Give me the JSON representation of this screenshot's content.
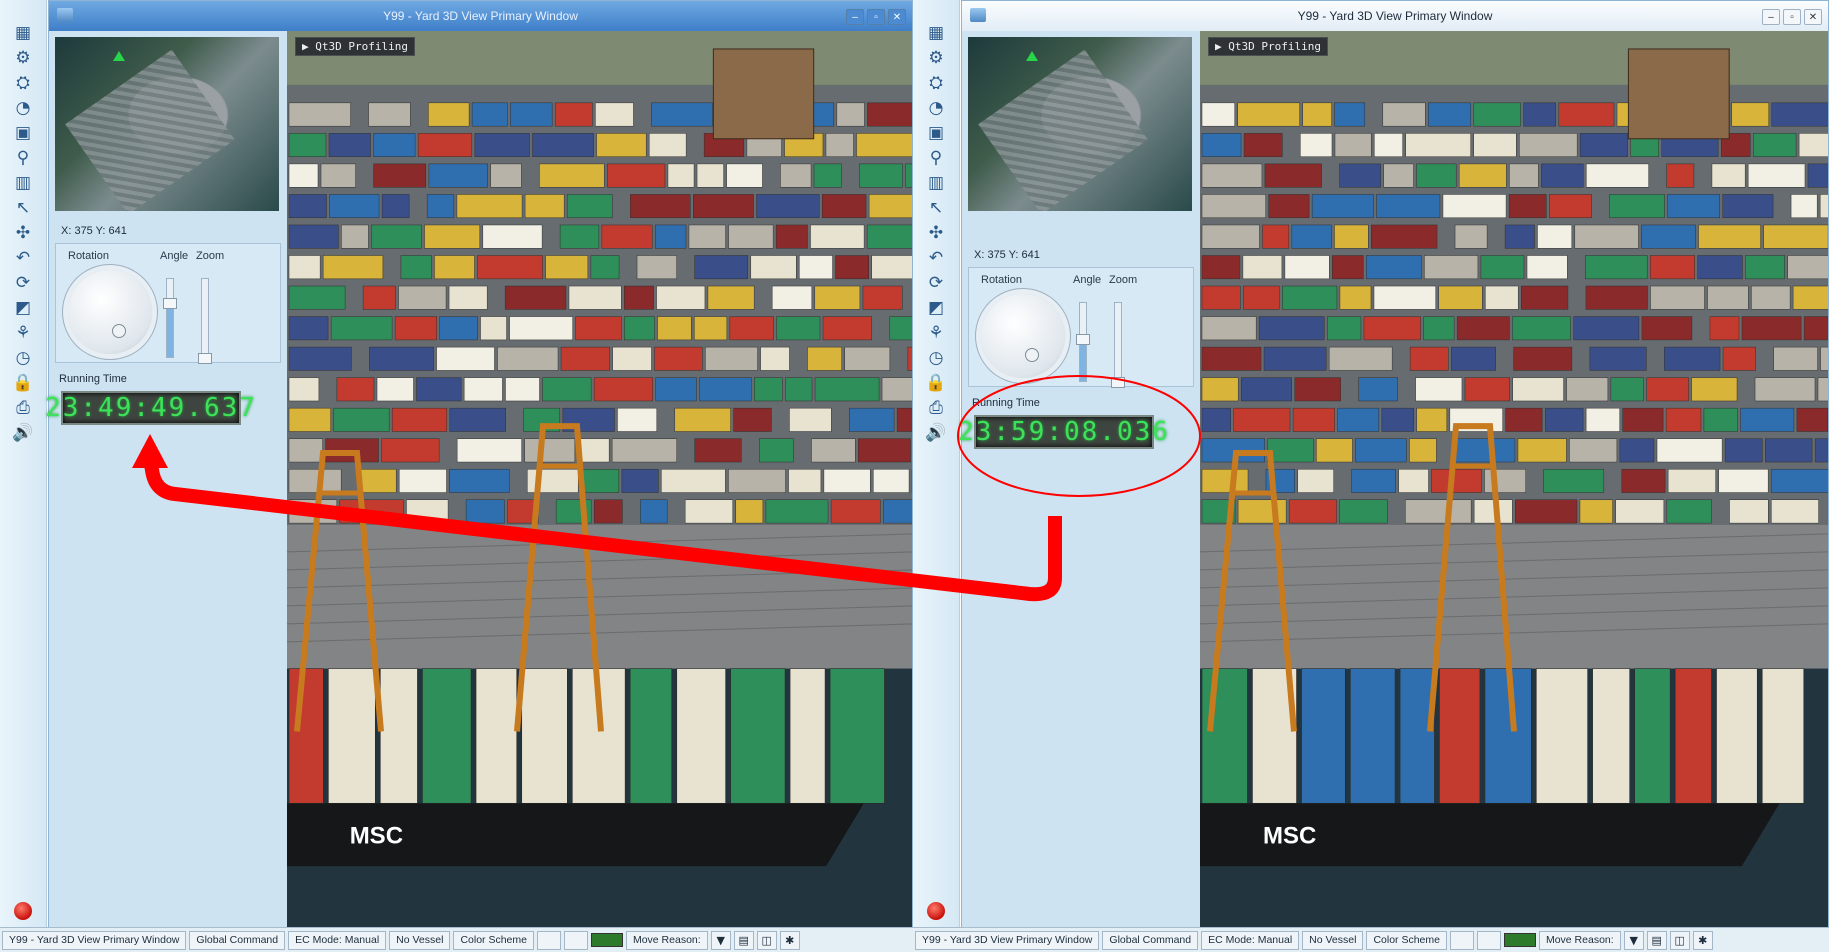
{
  "panes": [
    {
      "window_title": "Y99 - Yard 3D View Primary Window",
      "coords_text": "X: 375 Y: 641",
      "rotation_label": "Rotation",
      "angle_label": "Angle",
      "zoom_label": "Zoom",
      "running_time_label": "Running Time",
      "running_time": "23:49:49.637",
      "profiling_label": "▶ Qt3D Profiling",
      "angle_level": 0.7,
      "zoom_level": 0.0,
      "vessel_name": "MSC",
      "status": {
        "window": "Y99 - Yard 3D View Primary Window",
        "global_command": "Global Command",
        "ec_mode": "EC Mode: Manual",
        "vessel": "No Vessel",
        "color_scheme": "Color Scheme",
        "move_reason": "Move Reason:"
      }
    },
    {
      "window_title": "Y99 - Yard 3D View Primary Window",
      "coords_text": "X: 375 Y: 641",
      "rotation_label": "Rotation",
      "angle_label": "Angle",
      "zoom_label": "Zoom",
      "running_time_label": "Running Time",
      "running_time": "23:59:08.036",
      "profiling_label": "▶ Qt3D Profiling",
      "angle_level": 0.55,
      "zoom_level": 0.0,
      "vessel_name": "MSC",
      "status": {
        "window": "Y99 - Yard 3D View Primary Window",
        "global_command": "Global Command",
        "ec_mode": "EC Mode: Manual",
        "vessel": "No Vessel",
        "color_scheme": "Color Scheme",
        "move_reason": "Move Reason:"
      }
    }
  ],
  "toolbar_icons": [
    "layout-icon",
    "network-icon",
    "crane-icon",
    "gauge-icon",
    "capture-icon",
    "zoom-icon",
    "palette-icon",
    "pointer-icon",
    "scatter-icon",
    "undo-icon",
    "refresh-icon",
    "color-icon",
    "settings-icon",
    "clock-24-icon",
    "lock-icon",
    "print-icon",
    "sound-icon"
  ],
  "colors": {
    "highlight": "#ff0000",
    "lcd_green": "#3ee25a",
    "active_title": "#3f7fc9"
  }
}
